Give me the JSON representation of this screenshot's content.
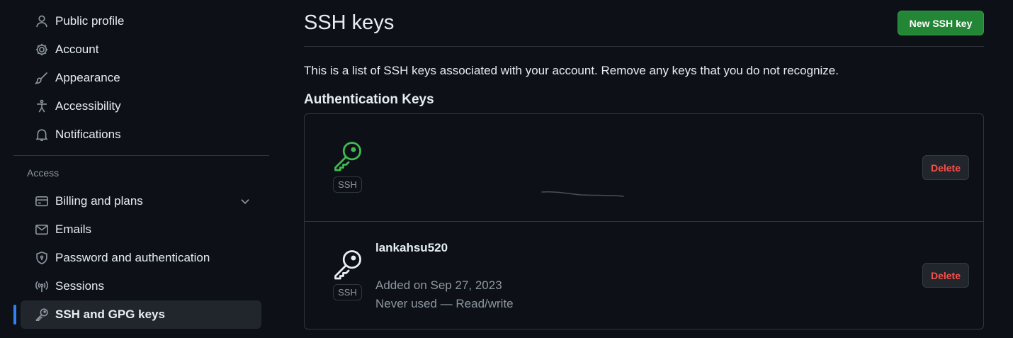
{
  "sidebar": {
    "items_top": [
      {
        "label": "Public profile",
        "icon": "person-icon"
      },
      {
        "label": "Account",
        "icon": "gear-icon"
      },
      {
        "label": "Appearance",
        "icon": "paintbrush-icon"
      },
      {
        "label": "Accessibility",
        "icon": "accessibility-icon"
      },
      {
        "label": "Notifications",
        "icon": "bell-icon"
      }
    ],
    "section_access": "Access",
    "items_access": [
      {
        "label": "Billing and plans",
        "icon": "credit-card-icon"
      },
      {
        "label": "Emails",
        "icon": "mail-icon"
      },
      {
        "label": "Password and authentication",
        "icon": "shield-lock-icon"
      },
      {
        "label": "Sessions",
        "icon": "broadcast-icon"
      },
      {
        "label": "SSH and GPG keys",
        "icon": "key-icon"
      }
    ]
  },
  "main": {
    "title": "SSH keys",
    "new_button": "New SSH key",
    "description": "This is a list of SSH keys associated with your account. Remove any keys that you do not recognize.",
    "section_title": "Authentication Keys",
    "keys": [
      {
        "name": "",
        "badge": "SSH",
        "added": "",
        "usage": "",
        "delete_label": "Delete",
        "icon_color": "#3fb950"
      },
      {
        "name": "lankahsu520",
        "badge": "SSH",
        "added": "Added on Sep 27, 2023",
        "usage": "Never used — Read/write",
        "delete_label": "Delete",
        "icon_color": "#e6edf3"
      }
    ]
  },
  "colors": {
    "background": "#0d1117",
    "accent_blue": "#2f81f7",
    "primary_green": "#238636",
    "danger_red": "#f85149"
  }
}
